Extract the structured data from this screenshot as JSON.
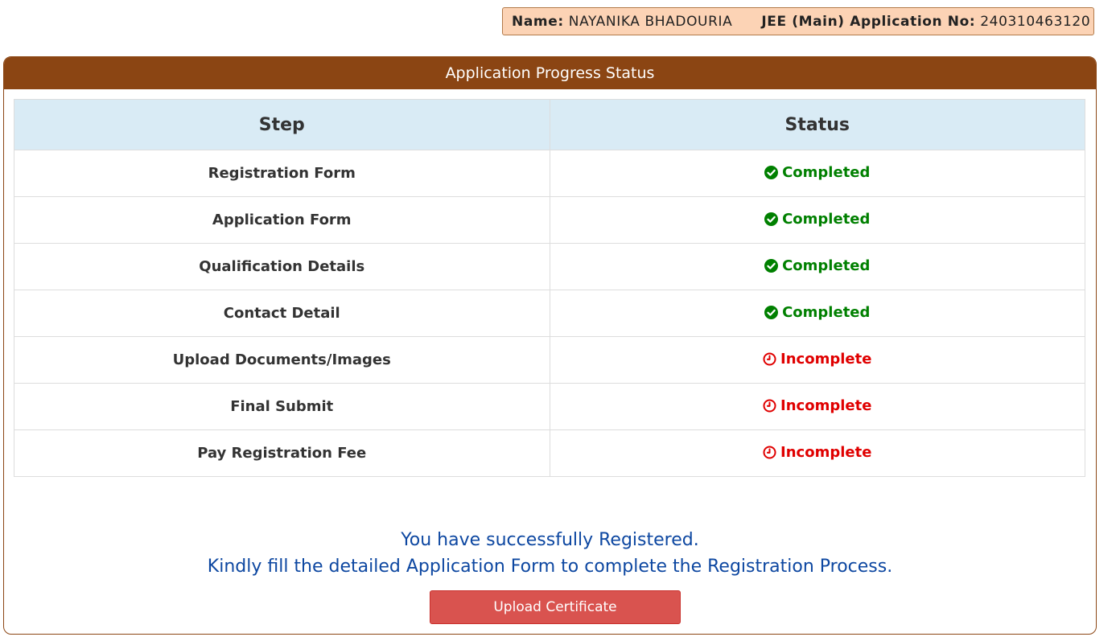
{
  "header": {
    "name_label": "Name:",
    "name_value": "NAYANIKA BHADOURIA",
    "app_no_label": "JEE (Main) Application No:",
    "app_no_value": "240310463120"
  },
  "panel": {
    "title": "Application Progress Status"
  },
  "table": {
    "headers": [
      "Step",
      "Status"
    ],
    "rows": [
      {
        "step": "Registration Form",
        "status": "Completed",
        "state": "completed",
        "icon": "check-circle-icon"
      },
      {
        "step": "Application Form",
        "status": "Completed",
        "state": "completed",
        "icon": "check-circle-icon"
      },
      {
        "step": "Qualification Details",
        "status": "Completed",
        "state": "completed",
        "icon": "check-circle-icon"
      },
      {
        "step": "Contact Detail",
        "status": "Completed",
        "state": "completed",
        "icon": "check-circle-icon"
      },
      {
        "step": "Upload Documents/Images",
        "status": "Incomplete",
        "state": "incomplete",
        "icon": "clock-icon"
      },
      {
        "step": "Final Submit",
        "status": "Incomplete",
        "state": "incomplete",
        "icon": "clock-icon"
      },
      {
        "step": "Pay Registration Fee",
        "status": "Incomplete",
        "state": "incomplete",
        "icon": "clock-icon"
      }
    ]
  },
  "message": {
    "line1": "You have successfully Registered.",
    "line2": "Kindly fill the detailed Application Form to complete the Registration Process."
  },
  "button": {
    "upload_label": "Upload Certificate"
  },
  "colors": {
    "brand": "#8b4513",
    "info_bg": "#fcd3b5",
    "completed": "#008000",
    "incomplete": "#e00000",
    "message": "#0d47a1",
    "button": "#d9534f"
  }
}
